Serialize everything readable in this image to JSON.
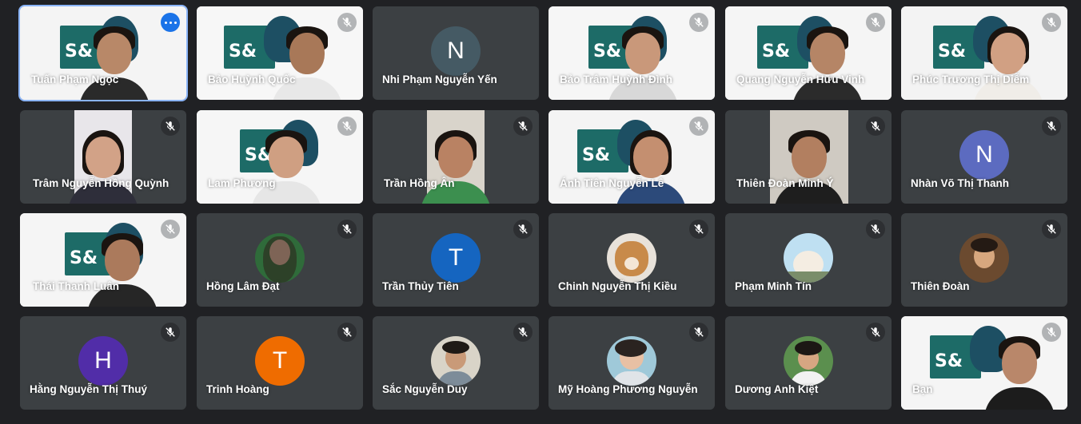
{
  "meeting": {
    "colors": {
      "background": "#202124",
      "tile": "#3c4043",
      "active_border": "#8ab4f8"
    },
    "participants": [
      {
        "name": "Tuấn Phạm Ngọc",
        "type": "video",
        "active": true,
        "icon": "more-options-icon"
      },
      {
        "name": "Bảo Huỳnh Quốc",
        "type": "video",
        "icon": "mic-off-icon"
      },
      {
        "name": "Nhi Phạm Nguyễn Yến",
        "type": "avatar-letter",
        "initial": "N",
        "avatar_color": "#455a64"
      },
      {
        "name": "Bảo Trâm Huỳnh Đình",
        "type": "video",
        "icon": "mic-off-icon"
      },
      {
        "name": "Quang Nguyễn Hữu Vinh",
        "type": "video",
        "icon": "mic-off-icon"
      },
      {
        "name": "Phúc Trương Thị Diễm",
        "type": "video",
        "icon": "mic-off-icon"
      },
      {
        "name": "Trâm Nguyễn Hồng Quỳnh",
        "type": "video",
        "icon": "mic-off-icon"
      },
      {
        "name": "Lam Phương",
        "type": "video",
        "icon": "mic-off-icon"
      },
      {
        "name": "Trần Hồng Ân",
        "type": "video",
        "icon": "mic-off-icon"
      },
      {
        "name": "Ánh Tiên Nguyễn Lê",
        "type": "video",
        "icon": "mic-off-icon"
      },
      {
        "name": "Thiên Đoàn Minh Ý",
        "type": "video",
        "icon": "mic-off-icon"
      },
      {
        "name": "Nhàn Võ Thị Thanh",
        "type": "avatar-letter",
        "initial": "N",
        "avatar_color": "#5c6bc0"
      },
      {
        "name": "Thái Thanh Luân",
        "type": "video",
        "icon": "mic-off-icon"
      },
      {
        "name": "Hồng Lâm Đạt",
        "type": "avatar-photo",
        "icon": "mic-off-icon"
      },
      {
        "name": "Trần Thủy Tiên",
        "type": "avatar-letter",
        "initial": "T",
        "avatar_color": "#1565c0"
      },
      {
        "name": "Chinh Nguyễn Thị Kiều",
        "type": "avatar-photo",
        "icon": "mic-off-icon"
      },
      {
        "name": "Phạm Minh Tín",
        "type": "avatar-photo",
        "icon": "mic-off-icon"
      },
      {
        "name": "Thiên Đoàn",
        "type": "avatar-photo",
        "icon": "mic-off-icon"
      },
      {
        "name": "Hằng Nguyễn Thị Thuý",
        "type": "avatar-letter",
        "initial": "H",
        "avatar_color": "#512da8"
      },
      {
        "name": "Trinh Hoàng",
        "type": "avatar-letter",
        "initial": "T",
        "avatar_color": "#ef6c00"
      },
      {
        "name": "Sắc Nguyễn Duy",
        "type": "avatar-photo",
        "icon": "mic-off-icon"
      },
      {
        "name": "Mỹ Hoàng Phương Nguyễn",
        "type": "avatar-photo",
        "icon": "mic-off-icon"
      },
      {
        "name": "Dương Anh Kiệt",
        "type": "avatar-photo",
        "icon": "mic-off-icon"
      },
      {
        "name": "Bạn",
        "type": "video",
        "icon": "mic-off-icon"
      }
    ]
  }
}
